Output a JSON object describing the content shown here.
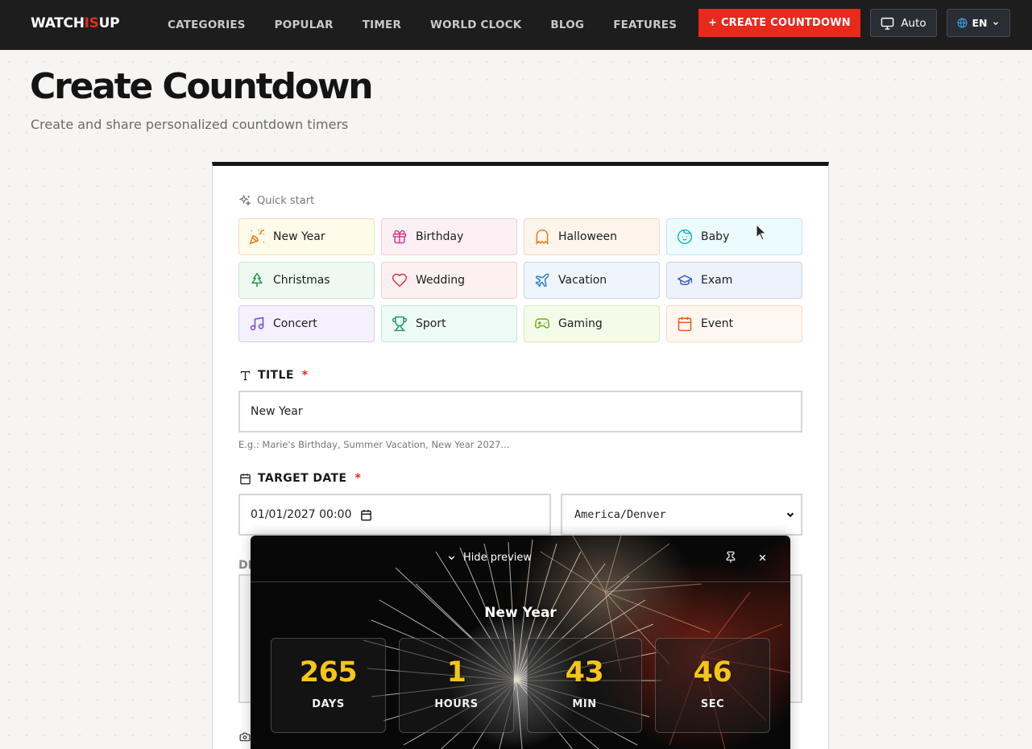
{
  "nav": {
    "logo_a": "WATCH",
    "logo_b": "IS",
    "logo_c": "UP",
    "links": [
      "CATEGORIES",
      "POPULAR",
      "TIMER",
      "WORLD CLOCK",
      "BLOG",
      "FEATURES"
    ],
    "create_label": "+ CREATE COUNTDOWN",
    "theme_label": "Auto",
    "lang_label": "EN"
  },
  "header": {
    "title": "Create Countdown",
    "subtitle": "Create and share personalized countdown timers"
  },
  "quick_start": {
    "label": "Quick start",
    "tiles": [
      {
        "label": "New Year",
        "icon": "party-popper-icon",
        "color": "#ea7a10"
      },
      {
        "label": "Birthday",
        "icon": "gift-icon",
        "color": "#e0348a"
      },
      {
        "label": "Halloween",
        "icon": "ghost-icon",
        "color": "#f07a1a"
      },
      {
        "label": "Baby",
        "icon": "baby-face-icon",
        "color": "#18b3c9"
      },
      {
        "label": "Christmas",
        "icon": "tree-icon",
        "color": "#1f9a4e"
      },
      {
        "label": "Wedding",
        "icon": "heart-icon",
        "color": "#e0365a"
      },
      {
        "label": "Vacation",
        "icon": "plane-icon",
        "color": "#2f7fd6"
      },
      {
        "label": "Exam",
        "icon": "graduation-cap-icon",
        "color": "#3a5fd0"
      },
      {
        "label": "Concert",
        "icon": "music-icon",
        "color": "#7a45d8"
      },
      {
        "label": "Sport",
        "icon": "trophy-icon",
        "color": "#1f9a74"
      },
      {
        "label": "Gaming",
        "icon": "gamepad-icon",
        "color": "#6bb21c"
      },
      {
        "label": "Event",
        "icon": "calendar-icon",
        "color": "#ea5a10"
      }
    ]
  },
  "form": {
    "title_label": "TITLE",
    "required_mark": "*",
    "title_value": "New Year",
    "title_hint": "E.g.: Marie's Birthday, Summer Vacation, New Year 2027...",
    "date_label": "TARGET DATE",
    "date_value": "01/01/2027 00:00",
    "timezone_value": "America/Denver",
    "hidden_label": "DI"
  },
  "preview": {
    "toggle_label": "Hide preview",
    "title": "New Year",
    "units": [
      {
        "value": "265",
        "label": "DAYS"
      },
      {
        "value": "1",
        "label": "HOURS"
      },
      {
        "value": "43",
        "label": "MIN"
      },
      {
        "value": "46",
        "label": "SEC"
      }
    ]
  },
  "colors": {
    "accent": "#e8291c",
    "nav_bg": "#1d1d1d",
    "counter": "#f5c518"
  }
}
